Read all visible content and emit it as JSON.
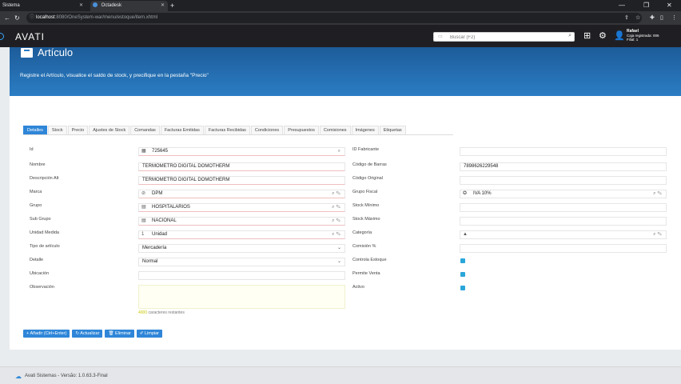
{
  "browser": {
    "tabs": [
      {
        "label": "Sistema"
      },
      {
        "label": "Octadesk"
      }
    ],
    "new_tab": "+",
    "url_host": "localhost",
    "url_path": ":8080/OneSystem-war/menu/estoque/item.xhtml",
    "window_controls": {
      "minimize": "—",
      "restore": "❐",
      "close": "✕"
    }
  },
  "header": {
    "logo": "AVATI",
    "search_placeholder": "Buscar (F2)",
    "user": {
      "name": "Rafael",
      "line2": "Caja registrada: 006",
      "line3": "Filial: 1"
    }
  },
  "banner": {
    "title": "Artículo",
    "subtitle": "Registre el Artículo, visualice el saldo de stock, y precifique en la pestaña \"Precio\""
  },
  "tabs": [
    {
      "label": "Detalles",
      "active": true
    },
    {
      "label": "Stock"
    },
    {
      "label": "Precio"
    },
    {
      "label": "Ajustes de Stock"
    },
    {
      "label": "Comandas"
    },
    {
      "label": "Facturas Emitidas"
    },
    {
      "label": "Facturas Recibidas"
    },
    {
      "label": "Condiciones"
    },
    {
      "label": "Presupuestos"
    },
    {
      "label": "Comisiones"
    },
    {
      "label": "Imágenes"
    },
    {
      "label": "Etiquetas"
    }
  ],
  "form_left": {
    "id": {
      "label": "Id",
      "value": "725645"
    },
    "nombre": {
      "label": "Nombre",
      "value": "TERMOMETRO DIGITAL DOMOTHERM"
    },
    "descripcion": {
      "label": "Descripción Alt",
      "value": "TERMOMETRO DIGITAL DOMOTHERM"
    },
    "marca": {
      "label": "Marca",
      "value": "DPM"
    },
    "grupo": {
      "label": "Grupo",
      "value": "HOSPITALARIOS"
    },
    "subgrupo": {
      "label": "Sub Grupo",
      "value": "NACIONAL"
    },
    "unidad": {
      "label": "Unidad Medida",
      "code": "1",
      "value": "Unidad"
    },
    "tipo": {
      "label": "Tipo de artículo",
      "value": "Mercadería"
    },
    "detalle": {
      "label": "Detalle",
      "value": "Normal"
    },
    "ubicacion": {
      "label": "Ubicación",
      "value": ""
    },
    "observacion": {
      "label": "Observación",
      "value": ""
    },
    "char_count": {
      "number": "4000",
      "text": "caracteres restantes"
    }
  },
  "form_right": {
    "id_fabricante": {
      "label": "ID Fabricante",
      "value": ""
    },
    "codigo_barras": {
      "label": "Código de Barras",
      "value": "7898626229548"
    },
    "codigo_original": {
      "label": "Código Original",
      "value": ""
    },
    "grupo_fiscal": {
      "label": "Grupo Fiscal",
      "value": "IVA 10%"
    },
    "stock_minimo": {
      "label": "Stock Mínimo",
      "value": ""
    },
    "stock_maximo": {
      "label": "Stock Máximo",
      "value": ""
    },
    "categoria": {
      "label": "Categoría",
      "value": ""
    },
    "comision": {
      "label": "Comisión %",
      "value": ""
    },
    "controla_estoque": {
      "label": "Controla Estoque",
      "checked": true
    },
    "permite_venta": {
      "label": "Permite Venta",
      "checked": true
    },
    "activo": {
      "label": "Activo",
      "checked": true
    }
  },
  "buttons": {
    "add": "Añadir (Ctrl+Enter)",
    "update": "Actualizar",
    "delete": "Eliminar",
    "clear": "Limpiar"
  },
  "footer": {
    "text": "Avati Sistemas - Versão: 1.0.63.3-Final"
  },
  "colors": {
    "accent": "#2f86d8",
    "banner": "#2b7dc4",
    "header": "#1f1f23"
  }
}
